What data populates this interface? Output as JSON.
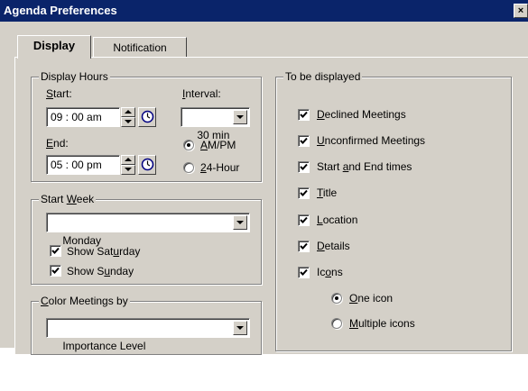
{
  "window": {
    "title": "Agenda Preferences",
    "close_glyph": "×"
  },
  "tabs": [
    {
      "label": "Display",
      "active": true
    },
    {
      "label": "Notification",
      "active": false
    }
  ],
  "display_hours": {
    "legend": "Display Hours",
    "start_label_u": "S",
    "start_label_rest": "tart:",
    "start_value": "09 : 00 am",
    "end_label_u": "E",
    "end_label_rest": "nd:",
    "end_value": "05 : 00 pm",
    "interval_label_u": "I",
    "interval_label_rest": "nterval:",
    "interval_value": "30 min",
    "format_ampm_u": "A",
    "format_ampm_rest": "M/PM",
    "format_24_pre": "",
    "format_24_u": "2",
    "format_24_rest": "4-Hour",
    "format_selected": "AM/PM"
  },
  "start_week": {
    "legend_pre": "Start ",
    "legend_u": "W",
    "legend_rest": "eek",
    "day_value": "Monday",
    "show_saturday_pre": "Show Sat",
    "show_saturday_u": "u",
    "show_saturday_rest": "rday",
    "show_saturday_checked": true,
    "show_sunday_pre": "Show S",
    "show_sunday_u": "u",
    "show_sunday_rest": "nday",
    "show_sunday_checked": true
  },
  "color_meetings": {
    "legend_u": "C",
    "legend_rest": "olor Meetings by",
    "value": "Importance Level"
  },
  "to_be_displayed": {
    "legend": "To be displayed",
    "items": [
      {
        "pre": "",
        "u": "D",
        "rest": "eclined Meetings",
        "checked": true
      },
      {
        "pre": "",
        "u": "U",
        "rest": "nconfirmed Meetings",
        "checked": true
      },
      {
        "pre": "Start ",
        "u": "a",
        "rest": "nd End times",
        "checked": true
      },
      {
        "pre": "",
        "u": "T",
        "rest": "itle",
        "checked": true
      },
      {
        "pre": "",
        "u": "L",
        "rest": "ocation",
        "checked": true
      },
      {
        "pre": "",
        "u": "D",
        "rest": "etails",
        "checked": true
      },
      {
        "pre": "Ic",
        "u": "o",
        "rest": "ns",
        "checked": true
      }
    ],
    "icon_options": [
      {
        "pre": "",
        "u": "O",
        "rest": "ne icon",
        "selected": true
      },
      {
        "pre": "",
        "u": "M",
        "rest": "ultiple icons",
        "selected": false
      }
    ]
  },
  "icons": {
    "spinner": "spinner-arrows-icon",
    "clock": "clock-icon",
    "dropdown": "chevron-down-icon",
    "check": "checkmark-icon",
    "close": "close-icon"
  },
  "colors": {
    "titlebar": "#0a246a",
    "face": "#d4d0c8",
    "shadow": "#808080",
    "highlight": "#ffffff"
  }
}
